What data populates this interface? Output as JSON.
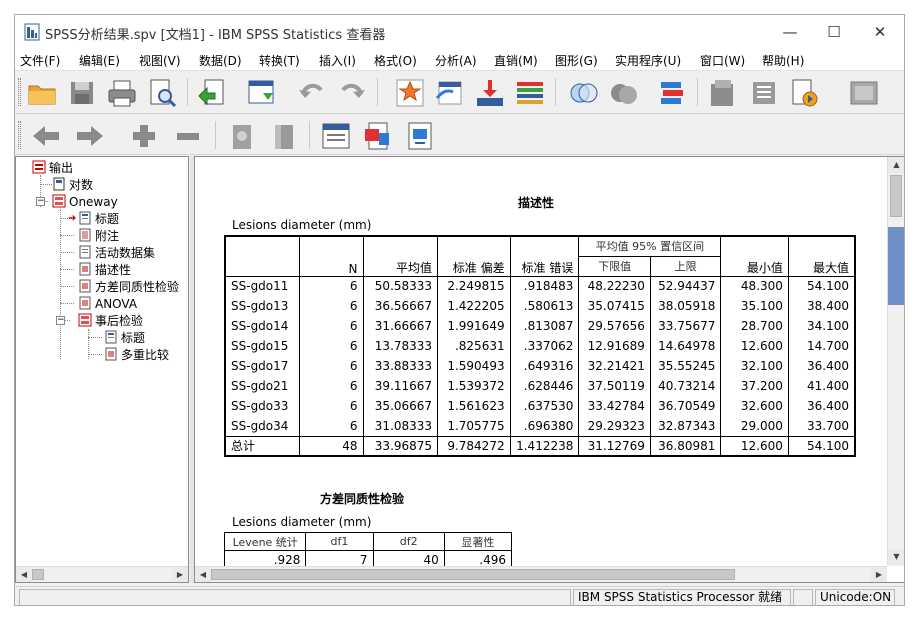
{
  "window": {
    "title": "SPSS分析结果.spv [文档1] - IBM SPSS Statistics 查看器",
    "min_symbol": "—",
    "max_symbol": "☐",
    "close_symbol": "✕"
  },
  "menubar": {
    "items": [
      "文件(F)",
      "编辑(E)",
      "视图(V)",
      "数据(D)",
      "转换(T)",
      "插入(I)",
      "格式(O)",
      "分析(A)",
      "直销(M)",
      "图形(G)",
      "实用程序(U)",
      "窗口(W)",
      "帮助(H)"
    ]
  },
  "toolbar1": {
    "buttons": [
      "open-folder-icon",
      "save-icon",
      "print-icon",
      "print-preview-icon",
      "export-icon",
      "recall-dialog-icon",
      "undo-icon",
      "redo-icon",
      "goto-data-icon",
      "goto-case-icon",
      "goto-variable-icon",
      "variables-icon",
      "venn-icon",
      "spheres-icon",
      "value-labels-icon",
      "pivot-icon",
      "script-icon",
      "designate-window-icon",
      "chart-window-icon"
    ]
  },
  "toolbar2": {
    "buttons": [
      "arrow-left-icon",
      "arrow-right-icon",
      "expand-icon",
      "collapse-icon",
      "show-icon",
      "hide-icon",
      "insert-heading-icon",
      "insert-title-icon",
      "insert-text-icon"
    ]
  },
  "outline": {
    "nodes": [
      {
        "label": "输出",
        "icon": "log-icon"
      },
      {
        "label": "对数",
        "icon": "log-book-icon"
      },
      {
        "label": "Oneway",
        "icon": "folder-icon"
      },
      {
        "label": "标题",
        "icon": "title-icon"
      },
      {
        "label": "附注",
        "icon": "notes-icon"
      },
      {
        "label": "活动数据集",
        "icon": "dataset-icon"
      },
      {
        "label": "描述性",
        "icon": "table-icon"
      },
      {
        "label": "方差同质性检验",
        "icon": "table-icon"
      },
      {
        "label": "ANOVA",
        "icon": "table-icon"
      },
      {
        "label": "事后检验",
        "icon": "folder-icon"
      },
      {
        "label": "标题",
        "icon": "title-icon"
      },
      {
        "label": "多重比较",
        "icon": "table-icon"
      }
    ]
  },
  "descriptives": {
    "caption": "描述性",
    "variable": "Lesions diameter (mm)",
    "headers": {
      "n": "N",
      "mean": "平均值",
      "sd": "标准 偏差",
      "se": "标准 错误",
      "ci": "平均值 95% 置信区间",
      "lower": "下限值",
      "upper": "上限",
      "min": "最小值",
      "max": "最大值"
    },
    "rows": [
      {
        "label": "SS-gdo11",
        "n": "6",
        "mean": "50.58333",
        "sd": "2.249815",
        "se": ".918483",
        "lower": "48.22230",
        "upper": "52.94437",
        "min": "48.300",
        "max": "54.100"
      },
      {
        "label": "SS-gdo13",
        "n": "6",
        "mean": "36.56667",
        "sd": "1.422205",
        "se": ".580613",
        "lower": "35.07415",
        "upper": "38.05918",
        "min": "35.100",
        "max": "38.400"
      },
      {
        "label": "SS-gdo14",
        "n": "6",
        "mean": "31.66667",
        "sd": "1.991649",
        "se": ".813087",
        "lower": "29.57656",
        "upper": "33.75677",
        "min": "28.700",
        "max": "34.100"
      },
      {
        "label": "SS-gdo15",
        "n": "6",
        "mean": "13.78333",
        "sd": ".825631",
        "se": ".337062",
        "lower": "12.91689",
        "upper": "14.64978",
        "min": "12.600",
        "max": "14.700"
      },
      {
        "label": "SS-gdo17",
        "n": "6",
        "mean": "33.88333",
        "sd": "1.590493",
        "se": ".649316",
        "lower": "32.21421",
        "upper": "35.55245",
        "min": "32.100",
        "max": "36.400"
      },
      {
        "label": "SS-gdo21",
        "n": "6",
        "mean": "39.11667",
        "sd": "1.539372",
        "se": ".628446",
        "lower": "37.50119",
        "upper": "40.73214",
        "min": "37.200",
        "max": "41.400"
      },
      {
        "label": "SS-gdo33",
        "n": "6",
        "mean": "35.06667",
        "sd": "1.561623",
        "se": ".637530",
        "lower": "33.42784",
        "upper": "36.70549",
        "min": "32.600",
        "max": "36.400"
      },
      {
        "label": "SS-gdo34",
        "n": "6",
        "mean": "31.08333",
        "sd": "1.705775",
        "se": ".696380",
        "lower": "29.29323",
        "upper": "32.87343",
        "min": "29.000",
        "max": "33.700"
      },
      {
        "label": "总计",
        "n": "48",
        "mean": "33.96875",
        "sd": "9.784272",
        "se": "1.412238",
        "lower": "31.12769",
        "upper": "36.80981",
        "min": "12.600",
        "max": "54.100"
      }
    ]
  },
  "homogeneity": {
    "caption": "方差同质性检验",
    "variable": "Lesions diameter (mm)",
    "headers": [
      "Levene 统计",
      "df1",
      "df2",
      "显著性"
    ],
    "values": [
      ".928",
      "7",
      "40",
      ".496"
    ]
  },
  "statusbar": {
    "processor": "IBM SPSS Statistics Processor 就绪",
    "unicode": "Unicode:ON"
  }
}
